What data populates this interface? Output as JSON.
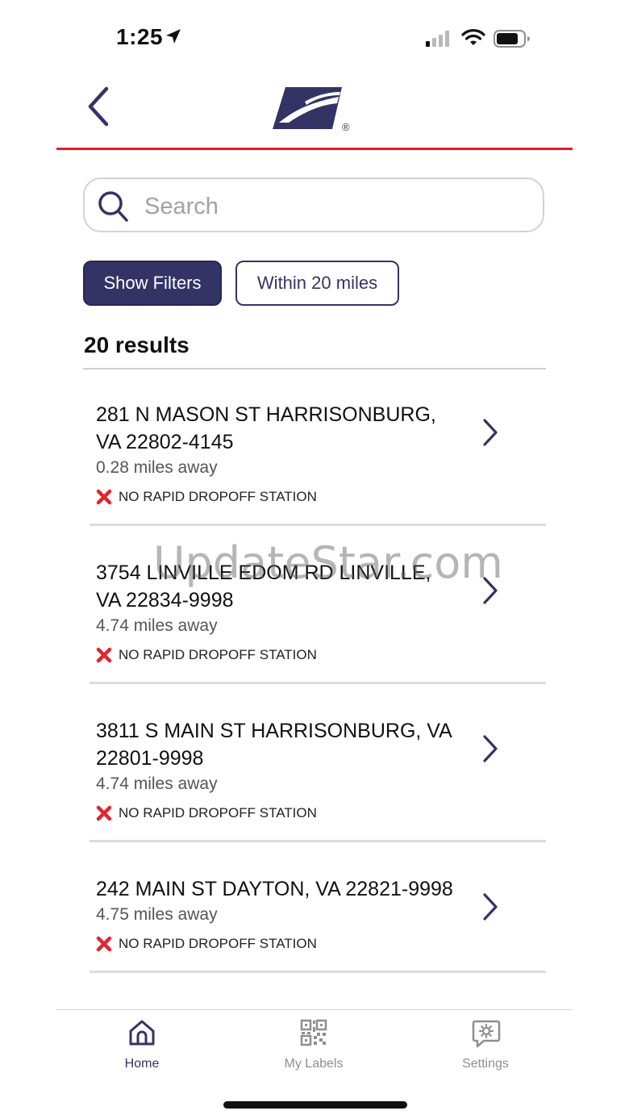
{
  "status_bar": {
    "time": "1:25"
  },
  "header": {
    "logo_icon": "usps-eagle-logo",
    "registered_mark": "®"
  },
  "search": {
    "placeholder": "Search",
    "value": ""
  },
  "filters": {
    "show_filters_label": "Show Filters",
    "radius_label": "Within 20 miles"
  },
  "results": {
    "count_label": "20 results",
    "items": [
      {
        "address_line1": "281 N MASON ST HARRISONBURG,",
        "address_line2": "VA 22802-4145",
        "distance": "0.28 miles away",
        "status": "NO RAPID DROPOFF STATION"
      },
      {
        "address_line1": "3754 LINVILLE EDOM RD LINVILLE,",
        "address_line2": "VA 22834-9998",
        "distance": "4.74 miles away",
        "status": "NO RAPID DROPOFF STATION"
      },
      {
        "address_line1": "3811 S MAIN ST HARRISONBURG, VA",
        "address_line2": "22801-9998",
        "distance": "4.74 miles away",
        "status": "NO RAPID DROPOFF STATION"
      },
      {
        "address_line1": "242 MAIN ST DAYTON, VA 22821-9998",
        "address_line2": "",
        "distance": "4.75 miles away",
        "status": "NO RAPID DROPOFF STATION"
      }
    ]
  },
  "nav": {
    "home_label": "Home",
    "labels_label": "My Labels",
    "settings_label": "Settings"
  },
  "watermark": "UpdateStar.com",
  "colors": {
    "brand_navy": "#333366",
    "accent_red": "#e21d2a",
    "status_red": "#e0262f"
  }
}
